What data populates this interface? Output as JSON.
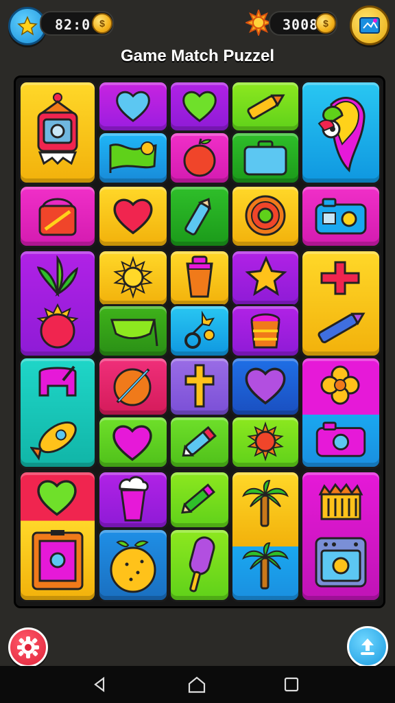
{
  "hud": {
    "score_value": "82:0",
    "coins_value": "3008",
    "coin_symbol": "$"
  },
  "title": "Game Match Puzzel",
  "icons": {
    "star_button": "star-icon",
    "coin": "coin-icon",
    "sun": "sun-icon",
    "map_button": "map-icon",
    "settings": "gear-icon",
    "upload": "upload-icon"
  },
  "colors": {
    "background": "#2b2a27",
    "board": "#161616",
    "yellow": "#f7d21a",
    "magenta": "#e619d8",
    "purple": "#9a1de0",
    "green": "#5fd11a",
    "blue": "#1aa8f0",
    "red": "#f0254f"
  },
  "navigation": [
    "back",
    "home",
    "recents"
  ]
}
